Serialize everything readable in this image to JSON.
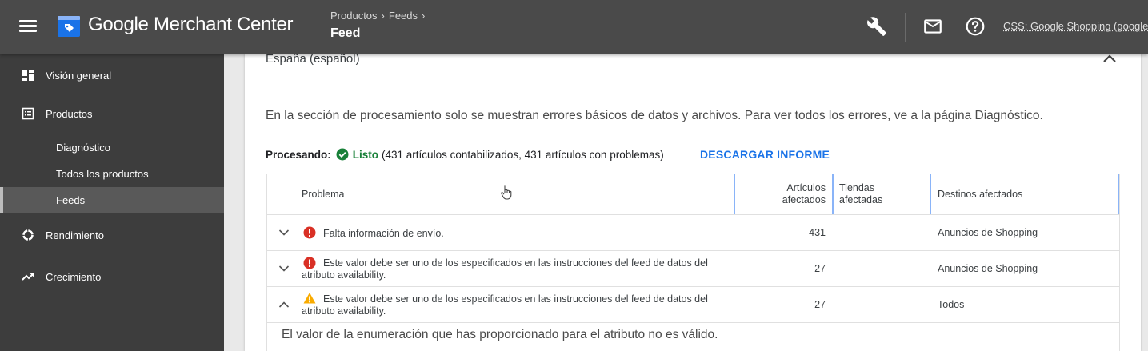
{
  "header": {
    "app_title": "Google Merchant Center",
    "breadcrumb": [
      "Productos",
      "Feeds"
    ],
    "page_title": "Feed",
    "account": "CSS: Google Shopping (google."
  },
  "sidebar": {
    "items": [
      {
        "label": "Visión general",
        "icon": "dashboard-icon"
      },
      {
        "label": "Productos",
        "icon": "list-icon"
      },
      {
        "label": "Diagnóstico",
        "icon": null
      },
      {
        "label": "Todos los productos",
        "icon": null
      },
      {
        "label": "Feeds",
        "icon": null,
        "active": true
      },
      {
        "label": "Rendimiento",
        "icon": "donut-icon"
      },
      {
        "label": "Crecimiento",
        "icon": "trending-icon"
      }
    ]
  },
  "main": {
    "section_title": "España (español)",
    "info": "En la sección de procesamiento solo se muestran errores básicos de datos y archivos. Para ver todos los errores, ve a la página Diagnóstico.",
    "processing_label": "Procesando:",
    "processing_status": "Listo",
    "processing_detail": "(431 artículos contabilizados, 431 artículos con problemas)",
    "download_label": "DESCARGAR INFORME",
    "table": {
      "headers": {
        "problem": "Problema",
        "items_line1": "Artículos",
        "items_line2": "afectados",
        "stores_line1": "Tiendas",
        "stores_line2": "afectadas",
        "destinations": "Destinos afectados"
      },
      "rows": [
        {
          "severity": "error",
          "expanded": false,
          "problem_line1": "Falta información de envío.",
          "problem_line2": "",
          "count": "431",
          "stores": "-",
          "destinations": "Anuncios de Shopping"
        },
        {
          "severity": "error",
          "expanded": false,
          "problem_line1": "Este valor debe ser uno de los especificados en las instrucciones del feed de datos del",
          "problem_line2": "atributo availability.",
          "count": "27",
          "stores": "-",
          "destinations": "Anuncios de Shopping"
        },
        {
          "severity": "warning",
          "expanded": true,
          "problem_line1": "Este valor debe ser uno de los especificados en las instrucciones del feed de datos del",
          "problem_line2": "atributo availability.",
          "count": "27",
          "stores": "-",
          "destinations": "Todos"
        }
      ],
      "expanded_detail": "El valor de la enumeración que has proporcionado para el atributo no es válido."
    }
  },
  "colors": {
    "topbar": "#4a4a4a",
    "sidebar": "#3d3d3d",
    "accent": "#1a73e8",
    "success": "#188038",
    "error": "#d93025",
    "warning": "#f9ab00"
  }
}
